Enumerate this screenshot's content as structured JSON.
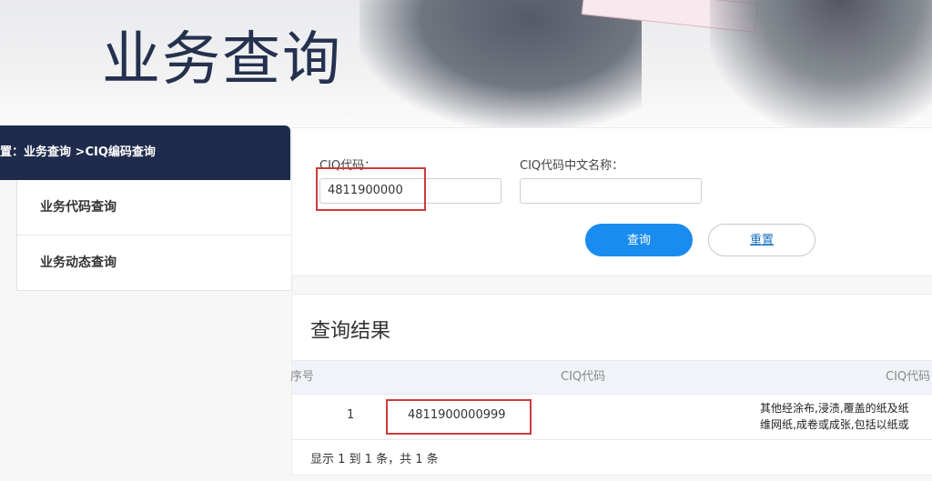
{
  "banner": {
    "title": "业务查询"
  },
  "breadcrumb": {
    "prefix": "置：",
    "path": "业务查询 > ",
    "current": "CIQ编码查询"
  },
  "sidebar": {
    "items": [
      {
        "label": "业务代码查询"
      },
      {
        "label": "业务动态查询"
      }
    ]
  },
  "search": {
    "ciq_code_label": "CIQ代码：",
    "ciq_code_value": "4811900000",
    "ciq_name_label": "CIQ代码中文名称：",
    "ciq_name_value": "",
    "query_button": "查询",
    "reset_button": "重置"
  },
  "results": {
    "title": "查询结果",
    "columns": [
      "序号",
      "CIQ代码",
      "CIQ代码"
    ],
    "rows": [
      {
        "index": "1",
        "ciq_code": "4811900000999",
        "description_line1": "其他经涂布,浸渍,覆盖的纸及纸",
        "description_line2": "维网纸,成卷或成张,包括以纸或"
      }
    ],
    "pagination_text": "显示 1 到 1 条，共 1 条"
  },
  "colors": {
    "nav_dark": "#1f2b4c",
    "primary": "#1a8cf0",
    "highlight_red": "#cc3b3b"
  }
}
